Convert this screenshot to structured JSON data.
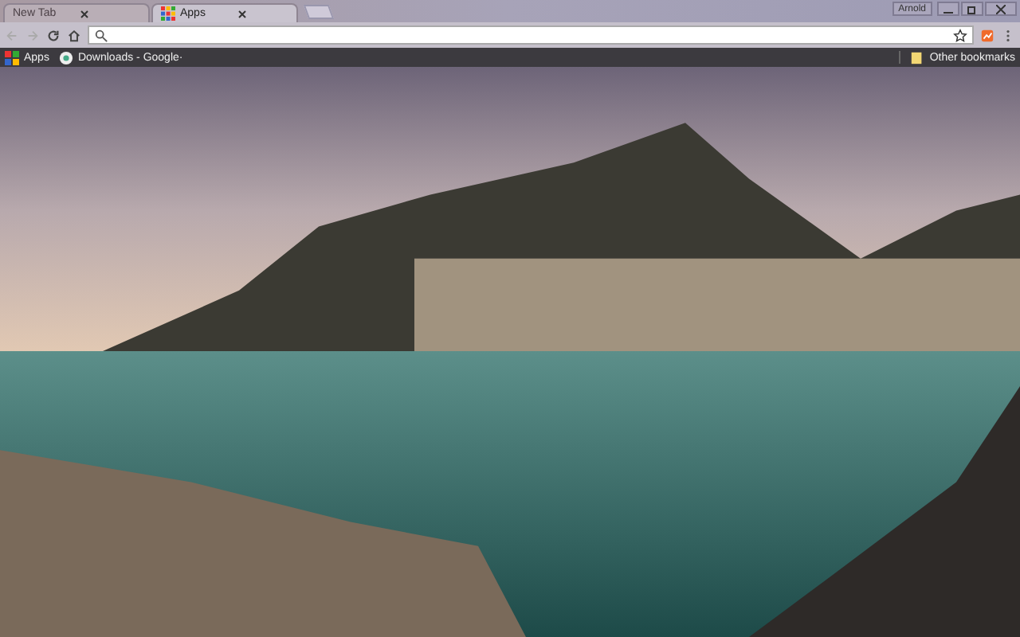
{
  "tabs": [
    {
      "title": "New Tab",
      "selected": false
    },
    {
      "title": "Apps",
      "selected": true
    }
  ],
  "profile": {
    "name": "Arnold"
  },
  "bookmarks": [
    {
      "kind": "apps",
      "label": "Apps"
    },
    {
      "kind": "site",
      "label": "Downloads - Google·"
    }
  ],
  "other_bookmarks": {
    "label": "Other bookmarks"
  }
}
